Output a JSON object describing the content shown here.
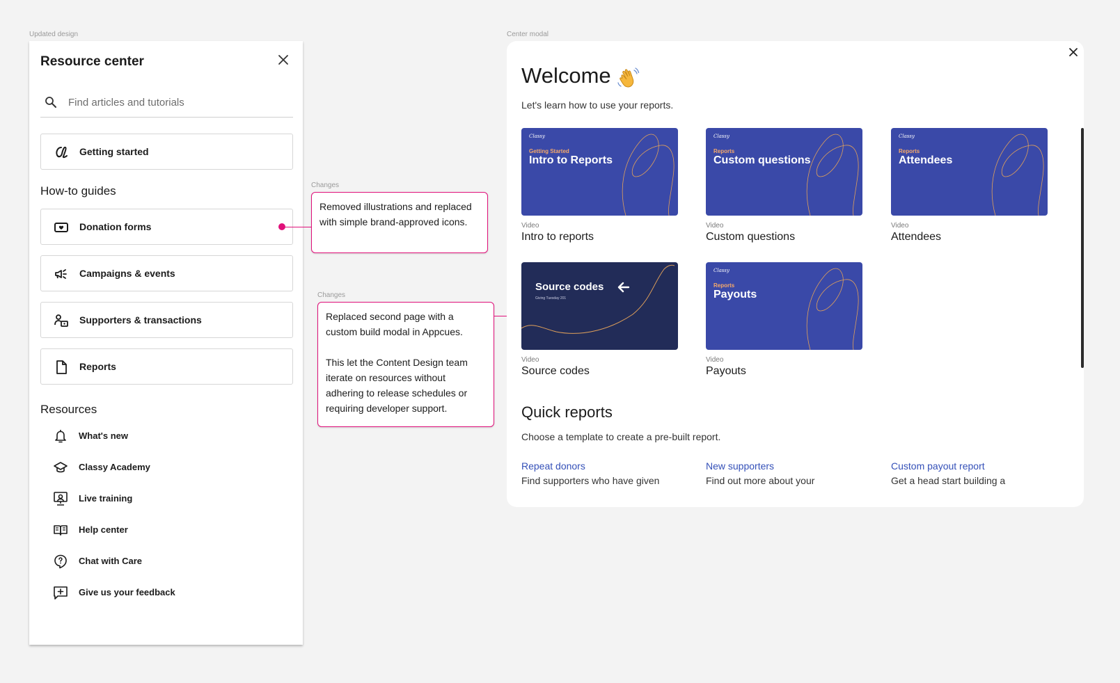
{
  "labels": {
    "updated_design": "Updated design",
    "center_modal": "Center modal"
  },
  "resource_center": {
    "title": "Resource center",
    "search_placeholder": "Find articles and tutorials",
    "getting_started": "Getting started",
    "howto_heading": "How-to guides",
    "howto": [
      {
        "label": "Donation forms",
        "icon": "donation-icon"
      },
      {
        "label": "Campaigns & events",
        "icon": "megaphone-icon"
      },
      {
        "label": "Supporters & transactions",
        "icon": "supporters-icon"
      },
      {
        "label": "Reports",
        "icon": "document-icon"
      }
    ],
    "resources_heading": "Resources",
    "resources": [
      {
        "label": "What's new",
        "icon": "bell-icon"
      },
      {
        "label": "Classy Academy",
        "icon": "graduation-cap-icon"
      },
      {
        "label": "Live training",
        "icon": "monitor-user-icon"
      },
      {
        "label": "Help center",
        "icon": "book-icon"
      },
      {
        "label": "Chat with Care",
        "icon": "help-bubble-icon"
      },
      {
        "label": "Give us your feedback",
        "icon": "feedback-icon"
      }
    ]
  },
  "annotations": [
    {
      "label": "Changes",
      "text": "Removed illustrations and replaced with simple brand-approved icons."
    },
    {
      "label": "Changes",
      "text_p1": "Replaced second page with a custom build modal in Appcues.",
      "text_p2": "This let the Content Design team iterate on resources without adhering to release schedules or requiring developer support."
    }
  ],
  "modal": {
    "welcome": "Welcome",
    "intro": "Let's learn how to use your reports.",
    "videos": [
      {
        "brand": "Classy",
        "kicker": "Getting Started",
        "thumb_title": "Intro to Reports",
        "type": "Video",
        "title": "Intro to reports"
      },
      {
        "brand": "Classy",
        "kicker": "Reports",
        "thumb_title": "Custom questions",
        "type": "Video",
        "title": "Custom questions"
      },
      {
        "brand": "Classy",
        "kicker": "Reports",
        "thumb_title": "Attendees",
        "type": "Video",
        "title": "Attendees"
      },
      {
        "thumb_title": "Source codes",
        "thumb_sub": "Giving Tuesday 201",
        "type": "Video",
        "title": "Source codes"
      },
      {
        "brand": "Classy",
        "kicker": "Reports",
        "thumb_title": "Payouts",
        "type": "Video",
        "title": "Payouts"
      }
    ],
    "quick_reports_title": "Quick reports",
    "quick_reports_sub": "Choose a template to create a pre-built report.",
    "quick_reports": [
      {
        "link": "Repeat donors",
        "desc": "Find supporters who have given"
      },
      {
        "link": "New supporters",
        "desc": "Find out more about your"
      },
      {
        "link": "Custom payout report",
        "desc": "Get a head start building a"
      }
    ]
  },
  "colors": {
    "annotation": "#e0107a",
    "thumb_blue": "#3a49a8",
    "thumb_dark": "#222c58",
    "link": "#3450b8"
  }
}
